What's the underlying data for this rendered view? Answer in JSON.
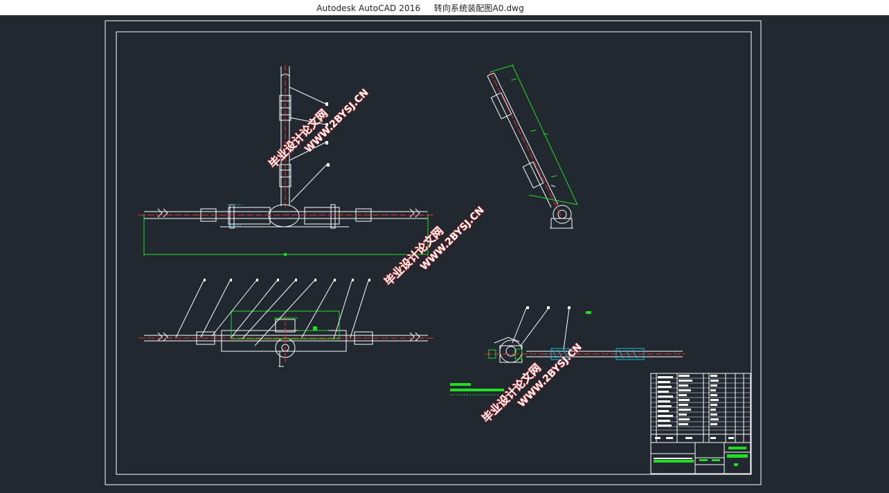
{
  "window": {
    "app_name": "Autodesk AutoCAD 2016",
    "file_name": "转向系统装配图A0.dwg"
  },
  "watermarks": [
    {
      "cn": "毕业设计论文网",
      "url": "WWW.2BYSJ.CN"
    },
    {
      "cn": "毕业设计论文网",
      "url": "WWW.2BYSJ.CN"
    },
    {
      "cn": "毕业设计论文网",
      "url": "WWW.2BYSJ.CN"
    }
  ],
  "colors": {
    "background": "#212830",
    "line": "#ffffff",
    "axis": "#ff2a2a",
    "dimension": "#22dd22",
    "hatch": "#00c8e0",
    "watermark_fill": "#ffffff",
    "watermark_stroke": "#e02020"
  }
}
